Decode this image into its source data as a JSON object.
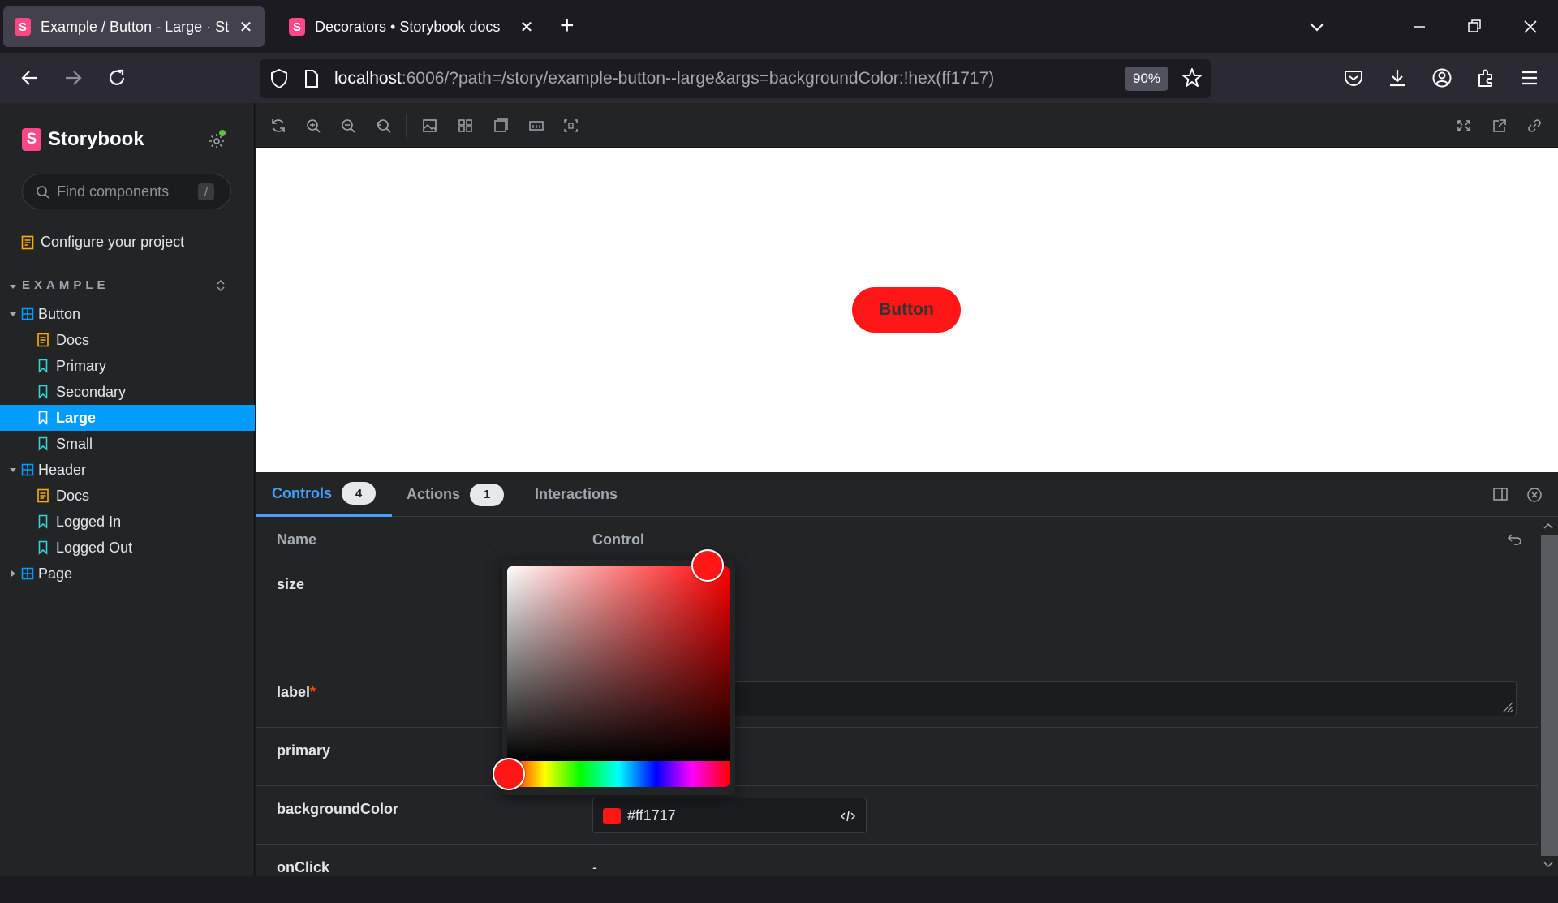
{
  "browser": {
    "tabs": [
      {
        "title": "Example / Button - Large · Storybook",
        "active": true
      },
      {
        "title": "Decorators • Storybook docs",
        "active": false
      }
    ],
    "url_host": "localhost",
    "url_path": ":6006/?path=/story/example-button--large&args=backgroundColor:!hex(ff1717)",
    "zoom": "90%"
  },
  "sidebar": {
    "brand": "Storybook",
    "search_placeholder": "Find components",
    "search_shortcut": "/",
    "configure": "Configure your project",
    "group": "EXAMPLE",
    "items": [
      {
        "label": "Button",
        "kind": "component"
      },
      {
        "label": "Docs",
        "kind": "docs"
      },
      {
        "label": "Primary",
        "kind": "story"
      },
      {
        "label": "Secondary",
        "kind": "story"
      },
      {
        "label": "Large",
        "kind": "story",
        "selected": true
      },
      {
        "label": "Small",
        "kind": "story"
      },
      {
        "label": "Header",
        "kind": "component"
      },
      {
        "label": "Docs",
        "kind": "docs"
      },
      {
        "label": "Logged In",
        "kind": "story"
      },
      {
        "label": "Logged Out",
        "kind": "story"
      },
      {
        "label": "Page",
        "kind": "component"
      }
    ]
  },
  "canvas": {
    "button_label": "Button",
    "button_color": "#ff1717"
  },
  "panel": {
    "tabs": [
      {
        "label": "Controls",
        "count": "4"
      },
      {
        "label": "Actions",
        "count": "1"
      },
      {
        "label": "Interactions",
        "count": ""
      }
    ],
    "columns": {
      "name": "Name",
      "control": "Control"
    },
    "rows": [
      {
        "name": "size"
      },
      {
        "name": "label",
        "required": "*"
      },
      {
        "name": "primary"
      },
      {
        "name": "backgroundColor",
        "value": "#ff1717"
      },
      {
        "name": "onClick",
        "value": "-"
      }
    ]
  },
  "colors": {
    "accent": "#029cfd",
    "storybook_pink": "#ff4785",
    "selected_color": "#ff1717"
  }
}
